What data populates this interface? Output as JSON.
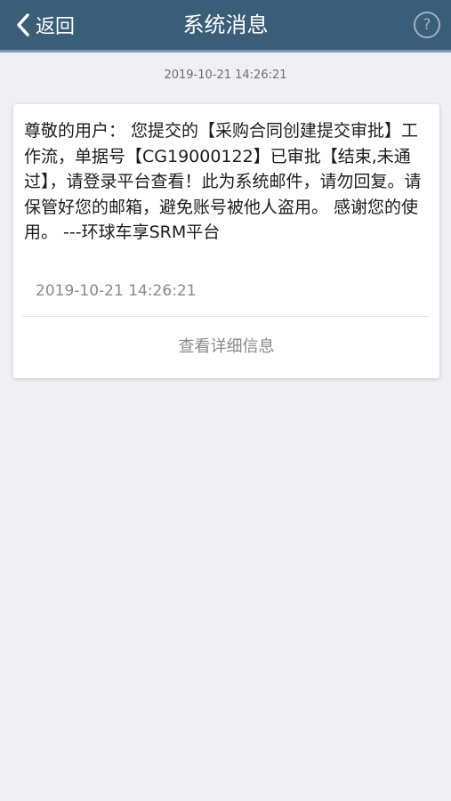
{
  "header": {
    "back_label": "返回",
    "title": "系统消息",
    "help_symbol": "?",
    "background_color": "#3a5d78"
  },
  "messages": [
    {
      "timestamp": "2019-10-21 14:26:21",
      "body": "尊敬的用户： 您提交的【采购合同创建提交审批】工作流，单据号【CG19000122】已审批【结束,未通过】，请登录平台查看！此为系统邮件，请勿回复。请保管好您的邮箱，避免账号被他人盗用。 感谢您的使用。 ---环球车享SRM平台",
      "time": "2019-10-21 14:26:21",
      "detail_link_label": "查看详细信息"
    }
  ],
  "icons": {
    "back": "chevron-left-icon",
    "help": "question-circle-icon"
  }
}
